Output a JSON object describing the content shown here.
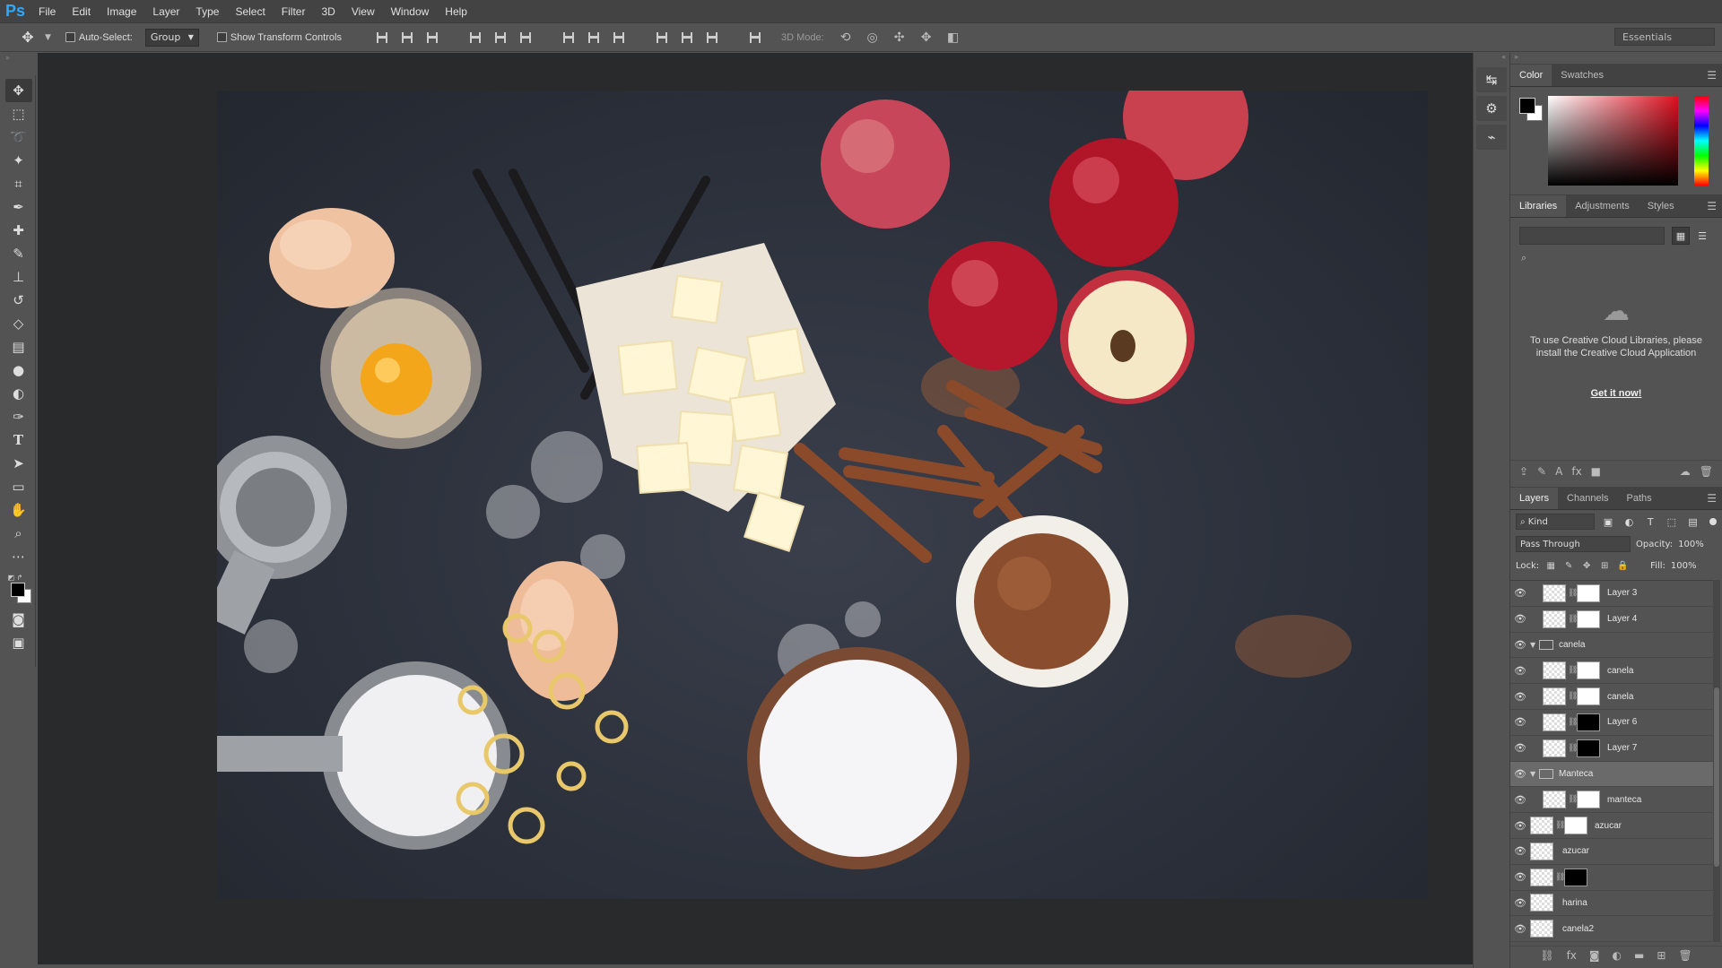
{
  "app": {
    "logo": "Ps"
  },
  "menu": [
    "File",
    "Edit",
    "Image",
    "Layer",
    "Type",
    "Select",
    "Filter",
    "3D",
    "View",
    "Window",
    "Help"
  ],
  "options": {
    "auto_select_label": "Auto-Select:",
    "auto_select_value": "Group",
    "show_transform_label": "Show Transform Controls",
    "mode3d_label": "3D Mode:",
    "workspace": "Essentials"
  },
  "color_panel": {
    "tabs": [
      "Color",
      "Swatches"
    ],
    "foreground": "#000000",
    "background": "#ffffff",
    "hue_color": "#e01020"
  },
  "libraries_panel": {
    "tabs": [
      "Libraries",
      "Adjustments",
      "Styles"
    ],
    "message": "To use Creative Cloud Libraries, please install the Creative Cloud Application",
    "link": "Get it now!"
  },
  "layers_panel": {
    "tabs": [
      "Layers",
      "Channels",
      "Paths"
    ],
    "kind": "Kind",
    "blend_mode": "Pass Through",
    "opacity_label": "Opacity:",
    "opacity": "100%",
    "lock_label": "Lock:",
    "fill_label": "Fill:",
    "fill": "100%",
    "layers": [
      {
        "name": "Layer 3",
        "type": "layer",
        "mask": "white",
        "indent": true
      },
      {
        "name": "Layer 4",
        "type": "layer",
        "mask": "white",
        "indent": true
      },
      {
        "name": "canela",
        "type": "group"
      },
      {
        "name": "canela",
        "type": "layer",
        "mask": "white",
        "indent": true
      },
      {
        "name": "canela",
        "type": "layer",
        "mask": "white",
        "indent": true
      },
      {
        "name": "Layer 6",
        "type": "layer",
        "mask": "black",
        "indent": true
      },
      {
        "name": "Layer 7",
        "type": "layer",
        "mask": "black",
        "indent": true
      },
      {
        "name": "Manteca",
        "type": "group",
        "selected": true
      },
      {
        "name": "manteca",
        "type": "layer",
        "mask": "white",
        "indent": true
      },
      {
        "name": "azucar",
        "type": "layer",
        "mask": "white"
      },
      {
        "name": "azucar",
        "type": "layer",
        "mask": "none"
      },
      {
        "name": "",
        "type": "layer",
        "mask": "black"
      },
      {
        "name": "harina",
        "type": "layer",
        "mask": "none"
      },
      {
        "name": "canela2",
        "type": "layer",
        "mask": "none"
      }
    ]
  }
}
